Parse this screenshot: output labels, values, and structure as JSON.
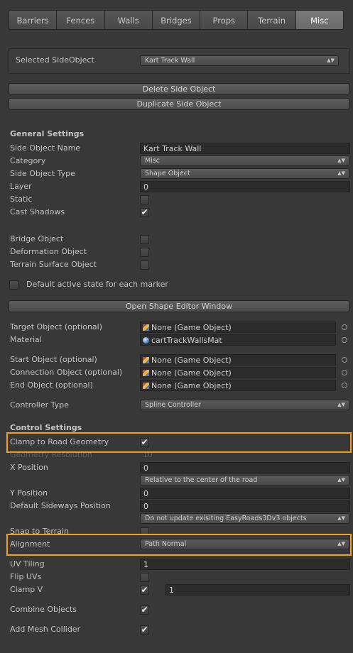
{
  "tabs": [
    "Barriers",
    "Fences",
    "Walls",
    "Bridges",
    "Props",
    "Terrain",
    "Misc"
  ],
  "selected_side_object": {
    "label": "Selected SideObject",
    "value": "Kart Track Wall"
  },
  "buttons": {
    "delete": "Delete Side Object",
    "duplicate": "Duplicate Side Object",
    "open_shape_editor": "Open Shape Editor Window"
  },
  "general": {
    "title": "General Settings",
    "name_label": "Side Object Name",
    "name_value": "Kart Track Wall",
    "category_label": "Category",
    "category_value": "Misc",
    "type_label": "Side Object Type",
    "type_value": "Shape Object",
    "layer_label": "Layer",
    "layer_value": "0",
    "static_label": "Static",
    "static_checked": false,
    "cast_shadows_label": "Cast Shadows",
    "cast_shadows_checked": true,
    "bridge_label": "Bridge Object",
    "bridge_checked": false,
    "deformation_label": "Deformation Object",
    "deformation_checked": false,
    "terrain_surface_label": "Terrain Surface Object",
    "terrain_surface_checked": false,
    "default_active_label": "Default active state for each marker",
    "default_active_checked": false
  },
  "objects": {
    "target_label": "Target Object (optional)",
    "target_value": "None (Game Object)",
    "material_label": "Material",
    "material_value": "cartTrackWallsMat",
    "start_label": "Start Object (optional)",
    "start_value": "None (Game Object)",
    "connection_label": "Connection Object (optional)",
    "connection_value": "None (Game Object)",
    "end_label": "End Object (optional)",
    "end_value": "None (Game Object)",
    "controller_label": "Controller Type",
    "controller_value": "Spline Controller"
  },
  "control": {
    "title": "Control Settings",
    "clamp_label": "Clamp to Road Geometry",
    "clamp_checked": true,
    "geometry_resolution_label": "Geometry Resolution",
    "geometry_resolution_value": "10",
    "x_position_label": "X Position",
    "x_position_value": "0",
    "x_position_mode": "Relative to the center of the road",
    "y_position_label": "Y Position",
    "y_position_value": "0",
    "default_sideways_label": "Default Sideways Position",
    "default_sideways_value": "0",
    "update_mode": "Do not update exisiting EasyRoads3Dv3 objects",
    "snap_label": "Snap to Terrain",
    "snap_checked": false,
    "alignment_label": "Alignment",
    "alignment_value": "Path Normal",
    "uv_tiling_label": "UV Tiling",
    "uv_tiling_value": "1",
    "flip_uvs_label": "Flip UVs",
    "flip_uvs_checked": false,
    "clamp_v_label": "Clamp V",
    "clamp_v_checked": true,
    "clamp_v_value": "1",
    "combine_label": "Combine Objects",
    "combine_checked": true,
    "mesh_collider_label": "Add Mesh Collider",
    "mesh_collider_checked": true
  },
  "colors": {
    "background": "#383838",
    "highlight": "#f2a11c",
    "active_tab": "#6e6e6e"
  }
}
